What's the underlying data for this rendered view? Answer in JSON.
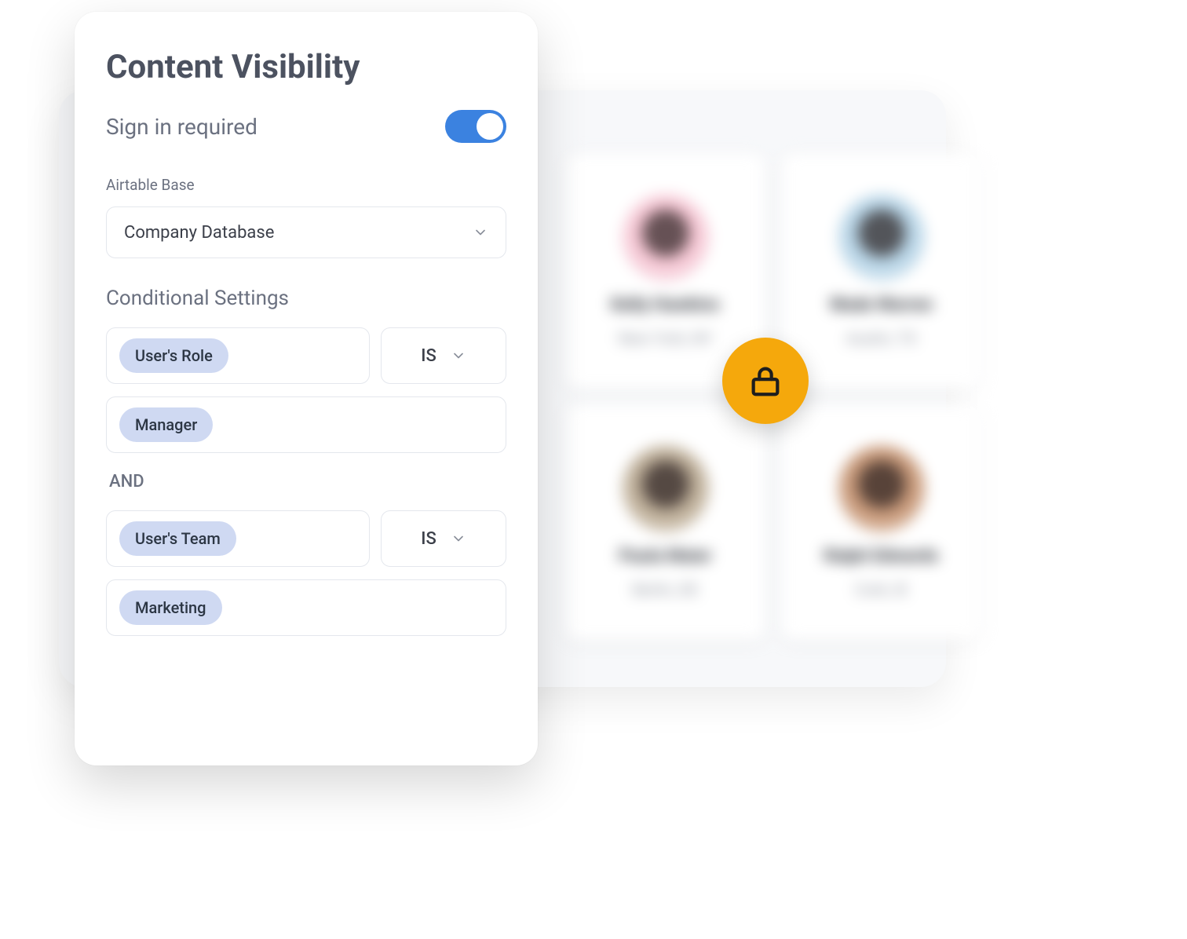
{
  "panel": {
    "title": "Content Visibility",
    "signin_label": "Sign in required",
    "signin_on": true,
    "base_label": "Airtable Base",
    "base_value": "Company Database",
    "conditional_heading": "Conditional Settings",
    "conditions": [
      {
        "field_chip": "User's Role",
        "op": "IS",
        "value_chip": "Manager"
      },
      {
        "joiner": "AND",
        "field_chip": "User's Team",
        "op": "IS",
        "value_chip": "Marketing"
      }
    ]
  },
  "team": {
    "cards": [
      {
        "name": "Kelly Hawkins",
        "loc": "New York, NY"
      },
      {
        "name": "Wade Warren",
        "loc": "Austin, TX"
      },
      {
        "name": "Paula Maier",
        "loc": "Berlin, DE"
      },
      {
        "name": "Ralph Edwards",
        "loc": "Cork, IE"
      }
    ]
  },
  "icons": {
    "lock": "lock-icon"
  }
}
